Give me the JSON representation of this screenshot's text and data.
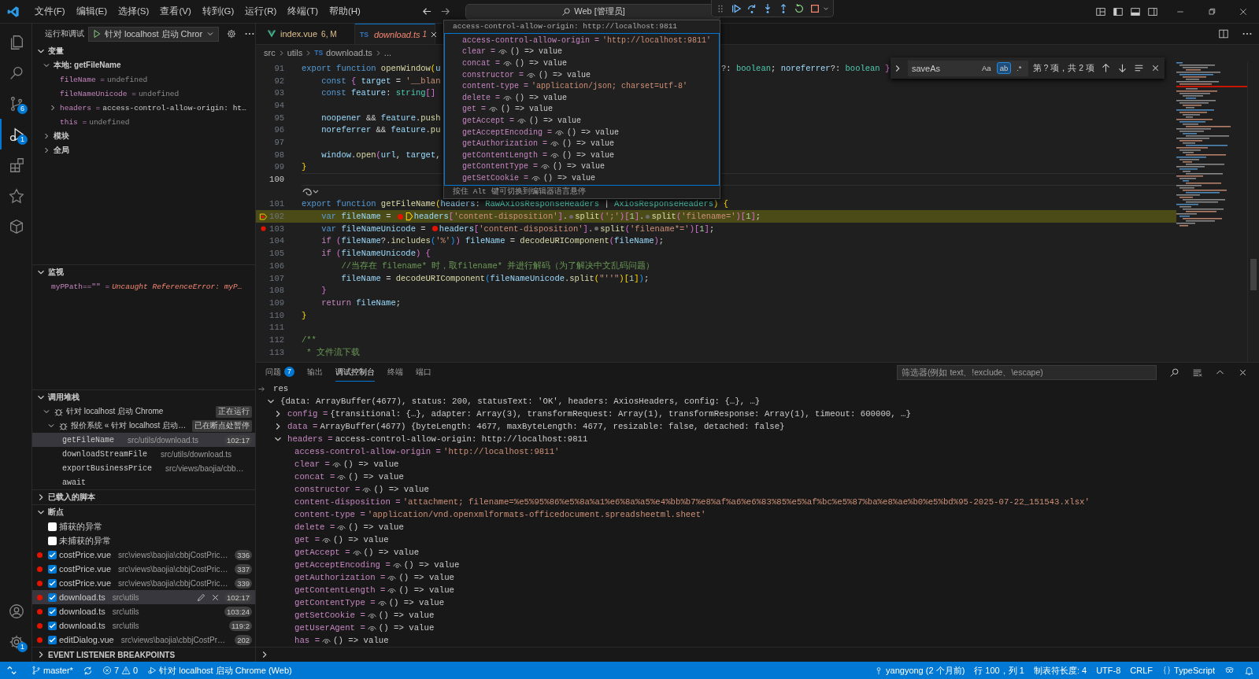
{
  "title_bar": {
    "menus": [
      "文件(F)",
      "编辑(E)",
      "选择(S)",
      "查看(V)",
      "转到(G)",
      "运行(R)",
      "终端(T)",
      "帮助(H)"
    ],
    "command_center": "Web [管理员]"
  },
  "activity_bar": {
    "top": [
      {
        "selected": false
      },
      {
        "selected": false
      },
      {
        "selected": false,
        "badge": "6"
      },
      {
        "selected": true,
        "badge": "1"
      },
      {
        "selected": false
      },
      {
        "selected": false
      },
      {
        "selected": false
      }
    ],
    "bottom": [
      {
        "selected": false
      },
      {
        "selected": false,
        "badge": "1"
      }
    ]
  },
  "sidebar": {
    "title": "运行和调试",
    "launch_config": "针对 localhost 启动 Chror",
    "variables": {
      "title": "变量",
      "expanded": true,
      "scopes": [
        {
          "label": "本地: getFileName",
          "kind": "scope",
          "expanded": true,
          "children": [
            {
              "label": "fileName =",
              "value": "undefined",
              "kind": "undefined"
            },
            {
              "label": "fileNameUnicode =",
              "value": "undefined",
              "kind": "undefined"
            },
            {
              "label": "headers =",
              "value": "access-control-allow-origin: ht…",
              "kind": "object",
              "expanded": false
            },
            {
              "label": "this =",
              "value": "undefined",
              "kind": "undefined"
            }
          ]
        },
        {
          "label": "模块",
          "kind": "scope",
          "expanded": false
        },
        {
          "label": "全局",
          "kind": "scope",
          "expanded": false
        }
      ]
    },
    "watch": {
      "title": "监视",
      "expanded": true,
      "items": [
        {
          "label": "myPPath==\"\" =",
          "value": "Uncaught ReferenceError: myP…",
          "kind": "error"
        }
      ]
    },
    "call_stack": {
      "title": "调用堆栈",
      "expanded": true,
      "sessions": [
        {
          "label": "针对 localhost 启动 Chrome",
          "status": "正在运行",
          "expanded": true,
          "children": [
            {
              "label": "报价系统 « 针对 localhost 启动…",
              "status": "已在断点处暂停",
              "expanded": true,
              "frames": [
                {
                  "name": "getFileName",
                  "source": "src/utils/download.ts",
                  "position": "102:17",
                  "selected": true
                },
                {
                  "name": "downloadStreamFile",
                  "source": "src/utils/download.ts",
                  "selected": false
                },
                {
                  "name": "exportBusinessPrice",
                  "source": "src/views/baojia/cbb…",
                  "selected": false
                },
                {
                  "name": "await",
                  "selected": false
                }
              ]
            }
          ]
        }
      ]
    },
    "loaded_scripts": {
      "title": "已载入的脚本",
      "expanded": false
    },
    "breakpoints": {
      "title": "断点",
      "expanded": true,
      "exceptions": [
        {
          "label": "捕获的异常",
          "checked": false
        },
        {
          "label": "未捕获的异常",
          "checked": false
        }
      ],
      "items": [
        {
          "file": "costPrice.vue",
          "path": "src\\views\\baojia\\cbbjCostPric…",
          "line": "336",
          "checked": true,
          "selected": false
        },
        {
          "file": "costPrice.vue",
          "path": "src\\views\\baojia\\cbbjCostPric…",
          "line": "337",
          "checked": true,
          "selected": false
        },
        {
          "file": "costPrice.vue",
          "path": "src\\views\\baojia\\cbbjCostPric…",
          "line": "339",
          "checked": true,
          "selected": false
        },
        {
          "file": "download.ts",
          "path": "src\\utils",
          "line": "102:17",
          "checked": true,
          "selected": true
        },
        {
          "file": "download.ts",
          "path": "src\\utils",
          "line": "103:24",
          "checked": true,
          "selected": false
        },
        {
          "file": "download.ts",
          "path": "src\\utils",
          "line": "119:2",
          "checked": true,
          "selected": false
        },
        {
          "file": "editDialog.vue",
          "path": "src\\views\\baojia\\cbbjCostPr…",
          "line": "202",
          "checked": true,
          "selected": false
        }
      ]
    },
    "event_breakpoints": {
      "title": "EVENT LISTENER BREAKPOINTS",
      "expanded": false
    }
  },
  "editor": {
    "tabs": [
      {
        "label": "index.vue",
        "badge": "6, M",
        "kind": "vue",
        "selected": false
      },
      {
        "label": "download.ts",
        "badge": "1",
        "kind": "ts",
        "icon": "TS",
        "selected": true
      }
    ],
    "breadcrumb": [
      {
        "label": "src"
      },
      {
        "label": "utils"
      },
      {
        "label": "download.ts",
        "icon": "TS"
      },
      {
        "label": "..."
      }
    ],
    "lines": [
      {
        "num": "91",
        "kind": "code",
        "tokens": [
          {
            "kind": "kw",
            "text": "export function "
          },
          {
            "kind": "fn",
            "text": "openWindow"
          },
          {
            "kind": "b1",
            "text": "("
          },
          {
            "kind": "var",
            "text": "u"
          }
        ],
        "tail": [
          {
            "kind": "pun",
            "text": "?: "
          },
          {
            "kind": "type",
            "text": "boolean"
          },
          {
            "kind": "pun",
            "text": "; "
          },
          {
            "kind": "var",
            "text": "noreferrer"
          },
          {
            "kind": "pun",
            "text": "?: "
          },
          {
            "kind": "type",
            "text": "boolean"
          },
          {
            "kind": "b2",
            "text": " }"
          }
        ]
      },
      {
        "num": "92",
        "kind": "code",
        "tokens": [
          {
            "kind": "kw",
            "text": "    const "
          },
          {
            "kind": "b2",
            "text": "{ "
          },
          {
            "kind": "var",
            "text": "target"
          },
          {
            "kind": "pun",
            "text": " = "
          },
          {
            "kind": "str",
            "text": "'__blan"
          }
        ]
      },
      {
        "num": "93",
        "kind": "code",
        "tokens": [
          {
            "kind": "kw",
            "text": "    const "
          },
          {
            "kind": "var",
            "text": "feature"
          },
          {
            "kind": "pun",
            "text": ": "
          },
          {
            "kind": "type",
            "text": "string"
          },
          {
            "kind": "b2",
            "text": "[]"
          }
        ]
      },
      {
        "num": "94",
        "kind": "code"
      },
      {
        "num": "95",
        "kind": "code",
        "tokens": [
          {
            "kind": "var",
            "text": "    noopener"
          },
          {
            "kind": "pun",
            "text": " && "
          },
          {
            "kind": "var",
            "text": "feature"
          },
          {
            "kind": "pun",
            "text": "."
          },
          {
            "kind": "fn",
            "text": "push"
          }
        ]
      },
      {
        "num": "96",
        "kind": "code",
        "tokens": [
          {
            "kind": "var",
            "text": "    noreferrer"
          },
          {
            "kind": "pun",
            "text": " && "
          },
          {
            "kind": "var",
            "text": "feature"
          },
          {
            "kind": "pun",
            "text": "."
          },
          {
            "kind": "fn",
            "text": "pu"
          }
        ]
      },
      {
        "num": "97",
        "kind": "code"
      },
      {
        "num": "98",
        "kind": "code",
        "tokens": [
          {
            "kind": "var",
            "text": "    window"
          },
          {
            "kind": "pun",
            "text": "."
          },
          {
            "kind": "fn",
            "text": "open"
          },
          {
            "kind": "b2",
            "text": "("
          },
          {
            "kind": "var",
            "text": "url"
          },
          {
            "kind": "pun",
            "text": ", "
          },
          {
            "kind": "var",
            "text": "target"
          },
          {
            "kind": "pun",
            "text": ","
          }
        ]
      },
      {
        "num": "99",
        "kind": "code",
        "tokens": [
          {
            "kind": "b1",
            "text": "}"
          }
        ]
      },
      {
        "num": "100",
        "kind": "current"
      },
      {
        "kind": "lens"
      },
      {
        "num": "101",
        "kind": "code",
        "tokens": [
          {
            "kind": "kw",
            "text": "export function "
          },
          {
            "kind": "fn",
            "text": "getFileName"
          },
          {
            "kind": "b1",
            "text": "("
          },
          {
            "kind": "var",
            "text": "headers"
          },
          {
            "kind": "pun",
            "text": ": "
          },
          {
            "kind": "type",
            "text": "RawAxiosResponseHeaders"
          },
          {
            "kind": "pun",
            "text": " | "
          },
          {
            "kind": "type",
            "text": "AxiosResponseHeaders"
          },
          {
            "kind": "b1",
            "text": ") {"
          }
        ]
      },
      {
        "num": "102",
        "kind": "paused",
        "breakpoint": true,
        "tokens": [
          {
            "kind": "kw",
            "text": "    var "
          },
          {
            "kind": "var",
            "text": "fileName"
          },
          {
            "kind": "pun",
            "text": " = "
          },
          {
            "kind": "bp"
          },
          {
            "kind": "cur"
          },
          {
            "kind": "var",
            "text": "headers"
          },
          {
            "kind": "b2",
            "text": "["
          },
          {
            "kind": "str",
            "text": "'content-disposition'"
          },
          {
            "kind": "b2",
            "text": "]"
          },
          {
            "kind": "pun",
            "text": "."
          },
          {
            "kind": "step"
          },
          {
            "kind": "fn",
            "text": "split"
          },
          {
            "kind": "b2",
            "text": "("
          },
          {
            "kind": "str",
            "text": "';'"
          },
          {
            "kind": "b2",
            "text": ")["
          },
          {
            "kind": "num",
            "text": "1"
          },
          {
            "kind": "b2",
            "text": "]"
          },
          {
            "kind": "pun",
            "text": "."
          },
          {
            "kind": "step"
          },
          {
            "kind": "fn",
            "text": "split"
          },
          {
            "kind": "b2",
            "text": "("
          },
          {
            "kind": "str",
            "text": "'filename='"
          },
          {
            "kind": "b2",
            "text": ")["
          },
          {
            "kind": "num",
            "text": "1"
          },
          {
            "kind": "b2",
            "text": "]"
          },
          {
            "kind": "pun",
            "text": ";"
          }
        ]
      },
      {
        "num": "103",
        "kind": "code",
        "breakpoint": true,
        "tokens": [
          {
            "kind": "kw",
            "text": "    var "
          },
          {
            "kind": "var",
            "text": "fileNameUnicode"
          },
          {
            "kind": "pun",
            "text": " = "
          },
          {
            "kind": "bp"
          },
          {
            "kind": "var",
            "text": "headers"
          },
          {
            "kind": "b2",
            "text": "["
          },
          {
            "kind": "str",
            "text": "'content-disposition'"
          },
          {
            "kind": "b2",
            "text": "]"
          },
          {
            "kind": "pun",
            "text": "."
          },
          {
            "kind": "step"
          },
          {
            "kind": "fn",
            "text": "split"
          },
          {
            "kind": "b2",
            "text": "("
          },
          {
            "kind": "str",
            "text": "'filename*='"
          },
          {
            "kind": "b2",
            "text": ")["
          },
          {
            "kind": "num",
            "text": "1"
          },
          {
            "kind": "b2",
            "text": "]"
          },
          {
            "kind": "pun",
            "text": ";"
          }
        ]
      },
      {
        "num": "104",
        "kind": "code",
        "tokens": [
          {
            "kind": "ctl",
            "text": "    if "
          },
          {
            "kind": "b2",
            "text": "("
          },
          {
            "kind": "var",
            "text": "fileName"
          },
          {
            "kind": "pun",
            "text": "?."
          },
          {
            "kind": "fn",
            "text": "includes"
          },
          {
            "kind": "b3",
            "text": "("
          },
          {
            "kind": "str",
            "text": "'%'"
          },
          {
            "kind": "b3",
            "text": ")"
          },
          {
            "kind": "b2",
            "text": ")"
          },
          {
            "kind": "var",
            "text": " fileName"
          },
          {
            "kind": "pun",
            "text": " = "
          },
          {
            "kind": "fn",
            "text": "decodeURIComponent"
          },
          {
            "kind": "b2",
            "text": "("
          },
          {
            "kind": "var",
            "text": "fileName"
          },
          {
            "kind": "b2",
            "text": ")"
          },
          {
            "kind": "pun",
            "text": ";"
          }
        ]
      },
      {
        "num": "105",
        "kind": "code",
        "tokens": [
          {
            "kind": "ctl",
            "text": "    if "
          },
          {
            "kind": "b2",
            "text": "("
          },
          {
            "kind": "var",
            "text": "fileNameUnicode"
          },
          {
            "kind": "b2",
            "text": ") {"
          }
        ]
      },
      {
        "num": "106",
        "kind": "code",
        "tokens": [
          {
            "kind": "com",
            "text": "        //当存在 filename* 时，取filename* 并进行解码（为了解决中文乱码问题）"
          }
        ]
      },
      {
        "num": "107",
        "kind": "code",
        "tokens": [
          {
            "kind": "var",
            "text": "        fileName"
          },
          {
            "kind": "pun",
            "text": " = "
          },
          {
            "kind": "fn",
            "text": "decodeURIComponent"
          },
          {
            "kind": "b3",
            "text": "("
          },
          {
            "kind": "var",
            "text": "fileNameUnicode"
          },
          {
            "kind": "pun",
            "text": "."
          },
          {
            "kind": "fn",
            "text": "split"
          },
          {
            "kind": "b1",
            "text": "("
          },
          {
            "kind": "str",
            "text": "\"''\""
          },
          {
            "kind": "b1",
            "text": ")["
          },
          {
            "kind": "num",
            "text": "1"
          },
          {
            "kind": "b1",
            "text": "]"
          },
          {
            "kind": "b3",
            "text": ")"
          },
          {
            "kind": "pun",
            "text": ";"
          }
        ]
      },
      {
        "num": "108",
        "kind": "code",
        "tokens": [
          {
            "kind": "b2",
            "text": "    }"
          }
        ]
      },
      {
        "num": "109",
        "kind": "code",
        "tokens": [
          {
            "kind": "ctl",
            "text": "    return "
          },
          {
            "kind": "var",
            "text": "fileName"
          },
          {
            "kind": "pun",
            "text": ";"
          }
        ]
      },
      {
        "num": "110",
        "kind": "code",
        "tokens": [
          {
            "kind": "b1",
            "text": "}"
          }
        ]
      },
      {
        "num": "111",
        "kind": "code"
      },
      {
        "num": "112",
        "kind": "code",
        "tokens": [
          {
            "kind": "com",
            "text": "/**"
          }
        ]
      },
      {
        "num": "113",
        "kind": "code",
        "tokens": [
          {
            "kind": "com",
            "text": " * 文件流下载"
          }
        ]
      }
    ],
    "hover": {
      "header": "access-control-allow-origin: http://localhost:9811",
      "items": [
        {
          "label": "access-control-allow-origin =",
          "value": "'http://localhost:9811'",
          "kind": "string"
        },
        {
          "label": "clear =",
          "value": "() => value",
          "kind": "getter"
        },
        {
          "label": "concat =",
          "value": "() => value",
          "kind": "getter"
        },
        {
          "label": "constructor =",
          "value": "() => value",
          "kind": "getter"
        },
        {
          "label": "content-type =",
          "value": "'application/json; charset=utf-8'",
          "kind": "string"
        },
        {
          "label": "delete =",
          "value": "() => value",
          "kind": "getter"
        },
        {
          "label": "get =",
          "value": "() => value",
          "kind": "getter"
        },
        {
          "label": "getAccept =",
          "value": "() => value",
          "kind": "getter"
        },
        {
          "label": "getAcceptEncoding =",
          "value": "() => value",
          "kind": "getter"
        },
        {
          "label": "getAuthorization =",
          "value": "() => value",
          "kind": "getter"
        },
        {
          "label": "getContentLength =",
          "value": "() => value",
          "kind": "getter"
        },
        {
          "label": "getContentType =",
          "value": "() => value",
          "kind": "getter"
        },
        {
          "label": "getSetCookie =",
          "value": "() => value",
          "kind": "getter"
        }
      ],
      "footer": "按住 Alt 键可切换到编辑器语言悬停"
    },
    "find": {
      "expanded": false,
      "query": "saveAs",
      "options": [
        {
          "label": "Aa",
          "selected": false
        },
        {
          "label": "ab",
          "selected": true
        },
        {
          "label": ".*",
          "selected": false
        }
      ],
      "result": "第 ? 项，共 2 项"
    }
  },
  "panel": {
    "tabs": [
      {
        "label": "问题",
        "badge": "7",
        "selected": false
      },
      {
        "label": "输出",
        "selected": false
      },
      {
        "label": "调试控制台",
        "selected": true
      },
      {
        "label": "终端",
        "selected": false
      },
      {
        "label": "端口",
        "selected": false
      }
    ],
    "filter_placeholder": "筛选器(例如 text、!exclude、\\escape)",
    "console": {
      "input": "res",
      "results": [
        {
          "value": "{data: ArrayBuffer(4677), status: 200, statusText: 'OK', headers: AxiosHeaders, config: {…}, …}",
          "kind": "object",
          "expanded": true,
          "children": [
            {
              "label": "config =",
              "value": "{transitional: {…}, adapter: Array(3), transformRequest: Array(1), transformResponse: Array(1), timeout: 600000, …}",
              "kind": "object",
              "expanded": false
            },
            {
              "label": "data =",
              "value": "ArrayBuffer(4677) {byteLength: 4677, maxByteLength: 4677, resizable: false, detached: false}",
              "kind": "object",
              "expanded": false
            },
            {
              "label": "headers =",
              "value": "access-control-allow-origin: http://localhost:9811",
              "kind": "object",
              "expanded": true,
              "children": [
                {
                  "label": "access-control-allow-origin =",
                  "value": "'http://localhost:9811'",
                  "kind": "string"
                },
                {
                  "label": "clear =",
                  "value": "() => value",
                  "kind": "getter"
                },
                {
                  "label": "concat =",
                  "value": "() => value",
                  "kind": "getter"
                },
                {
                  "label": "constructor =",
                  "value": "() => value",
                  "kind": "getter"
                },
                {
                  "label": "content-disposition =",
                  "value": "'attachment; filename=%e5%95%86%e5%8a%a1%e6%8a%a5%e4%bb%b7%e8%af%a6%e6%83%85%e5%af%bc%e5%87%ba%e8%ae%b0%e5%bd%95-2025-07-22_151543.xlsx'",
                  "kind": "string"
                },
                {
                  "label": "content-type =",
                  "value": "'application/vnd.openxmlformats-officedocument.spreadsheetml.sheet'",
                  "kind": "string"
                },
                {
                  "label": "delete =",
                  "value": "() => value",
                  "kind": "getter"
                },
                {
                  "label": "get =",
                  "value": "() => value",
                  "kind": "getter"
                },
                {
                  "label": "getAccept =",
                  "value": "() => value",
                  "kind": "getter"
                },
                {
                  "label": "getAcceptEncoding =",
                  "value": "() => value",
                  "kind": "getter"
                },
                {
                  "label": "getAuthorization =",
                  "value": "() => value",
                  "kind": "getter"
                },
                {
                  "label": "getContentLength =",
                  "value": "() => value",
                  "kind": "getter"
                },
                {
                  "label": "getContentType =",
                  "value": "() => value",
                  "kind": "getter"
                },
                {
                  "label": "getSetCookie =",
                  "value": "() => value",
                  "kind": "getter"
                },
                {
                  "label": "getUserAgent =",
                  "value": "() => value",
                  "kind": "getter"
                },
                {
                  "label": "has =",
                  "value": "() => value",
                  "kind": "getter"
                }
              ]
            }
          ]
        }
      ]
    }
  },
  "status_bar": {
    "branch": "master*",
    "errors": "7",
    "warnings": "0",
    "debug": "针对 localhost 启动 Chrome (Web)",
    "blame": "yangyong (2 个月前)",
    "cursor": "行 100，列 1",
    "indent": "制表符长度: 4",
    "encoding": "UTF-8",
    "eol": "CRLF",
    "language": "TypeScript"
  }
}
